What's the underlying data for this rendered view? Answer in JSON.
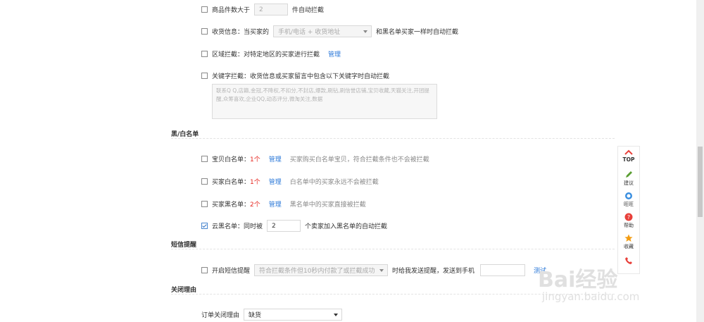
{
  "filters": {
    "item_count": {
      "label_pre": "商品件数大于",
      "value": "2",
      "label_post": "件自动拦截"
    },
    "receiver": {
      "label": "收货信息：当买家的",
      "select": "手机/电话 + 收货地址",
      "label_post": "和黑名单买家一样时自动拦截"
    },
    "region": {
      "label": "区域拦截：对特定地区的买家进行拦截",
      "link": "管理"
    },
    "keyword": {
      "label": "关键字拦截：收货信息或买家留言中包含以下关键字时自动拦截",
      "placeholder": "联系Q Q,店籍,金冠,不降权,不扣分,不封店,爆款,刷钻,刷信誉店铺,宝贝收藏,天猫关注,开团提醒,众筹喜欢,企业QQ,动态评分,微淘关注,数据"
    }
  },
  "blackwhite": {
    "title": "黑/白名单",
    "item_white": {
      "label": "宝贝白名单：",
      "count": "1个",
      "link": "管理",
      "desc": "买家购买白名单宝贝，符合拦截条件也不会被拦截"
    },
    "buyer_white": {
      "label": "买家白名单：",
      "count": "1个",
      "link": "管理",
      "desc": "白名单中的买家永远不会被拦截"
    },
    "buyer_black": {
      "label": "买家黑名单：",
      "count": "2个",
      "link": "管理",
      "desc": "黑名单中的买家直接被拦截"
    },
    "cloud_black": {
      "label": "云黑名单：同时被",
      "value": "2",
      "label_post": "个卖家加入黑名单的自动拦截"
    }
  },
  "sms": {
    "title": "短信提醒",
    "label": "开启短信提醒",
    "select": "符合拦截条件但10秒内付款了或拦截成功",
    "label_post": "时给我发送提醒，发送到手机",
    "test": "测试"
  },
  "close_reason": {
    "title": "关闭理由",
    "label": "订单关闭理由",
    "select": "缺货"
  },
  "sidebar": {
    "top": "TOP",
    "suggest": "建议",
    "wangwang": "旺旺",
    "help": "帮助",
    "favorite": "收藏"
  },
  "watermark": {
    "brand": "Bai经验",
    "url": "jingyan.baidu.com"
  },
  "colors": {
    "accent": "#2b78d8",
    "red": "#e6261f",
    "sidebar_red": "#e8403a",
    "green": "#5a9e32",
    "orange": "#f39c12"
  }
}
